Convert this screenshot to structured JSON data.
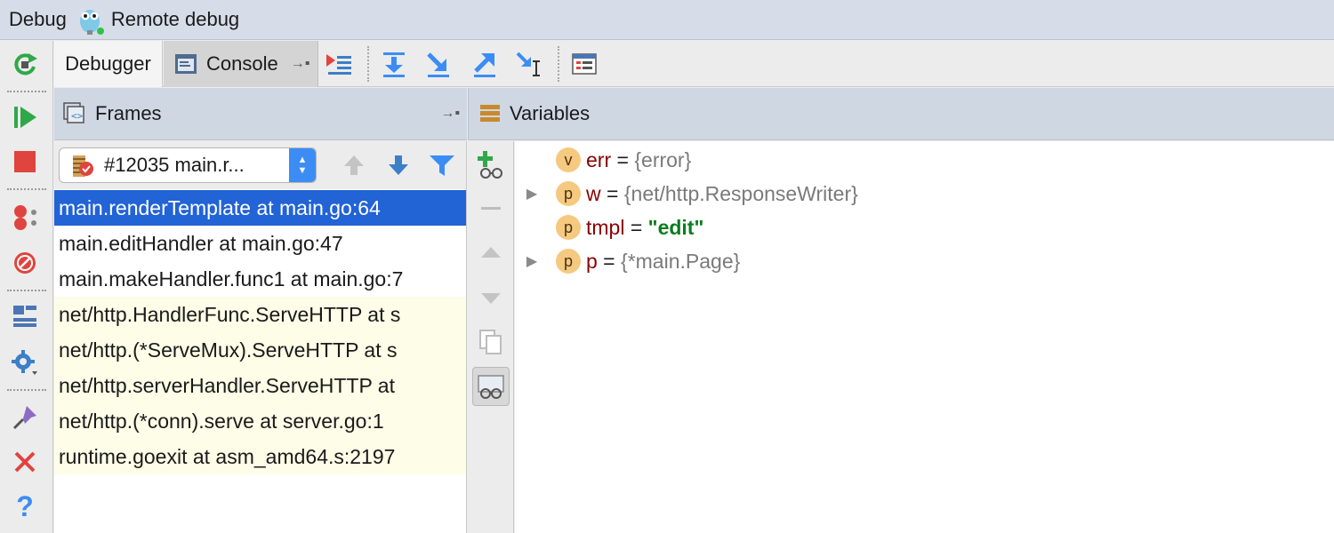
{
  "title": {
    "debug_label": "Debug",
    "config_name": "Remote debug"
  },
  "tabs": {
    "debugger": "Debugger",
    "console": "Console"
  },
  "frames": {
    "header": "Frames",
    "thread": "#12035 main.r...",
    "items": [
      "main.renderTemplate at main.go:64",
      "main.editHandler at main.go:47",
      "main.makeHandler.func1 at main.go:7",
      "net/http.HandlerFunc.ServeHTTP at s",
      "net/http.(*ServeMux).ServeHTTP at s",
      "net/http.serverHandler.ServeHTTP at",
      "net/http.(*conn).serve at server.go:1",
      "runtime.goexit at asm_amd64.s:2197"
    ]
  },
  "variables": {
    "header": "Variables",
    "items": [
      {
        "badge": "v",
        "name": "err",
        "eq": " = ",
        "value": "{error}"
      },
      {
        "badge": "p",
        "name": "w",
        "eq": " = ",
        "value": "{net/http.ResponseWriter}"
      },
      {
        "badge": "p",
        "name": "tmpl",
        "eq": " = ",
        "value": "\"edit\""
      },
      {
        "badge": "p",
        "name": "p",
        "eq": " = ",
        "value": "{*main.Page}"
      }
    ]
  },
  "colors": {
    "selection": "#2263d6",
    "header_bg": "#cfd7e3",
    "variable_name": "#8b0000",
    "string_value": "#0a7d1e",
    "badge": "#f5c97f"
  },
  "icons": {
    "left_toolbar": [
      "rerun-icon",
      "resume-icon",
      "stop-icon",
      "view-breakpoints-icon",
      "mute-breakpoints-icon",
      "restore-layout-icon",
      "settings-icon",
      "pin-icon",
      "close-icon",
      "help-icon"
    ],
    "top_toolbar": [
      "show-execution-point-icon",
      "step-over-icon",
      "step-into-icon",
      "step-out-icon",
      "run-to-cursor-icon",
      "evaluate-expression-icon"
    ]
  }
}
